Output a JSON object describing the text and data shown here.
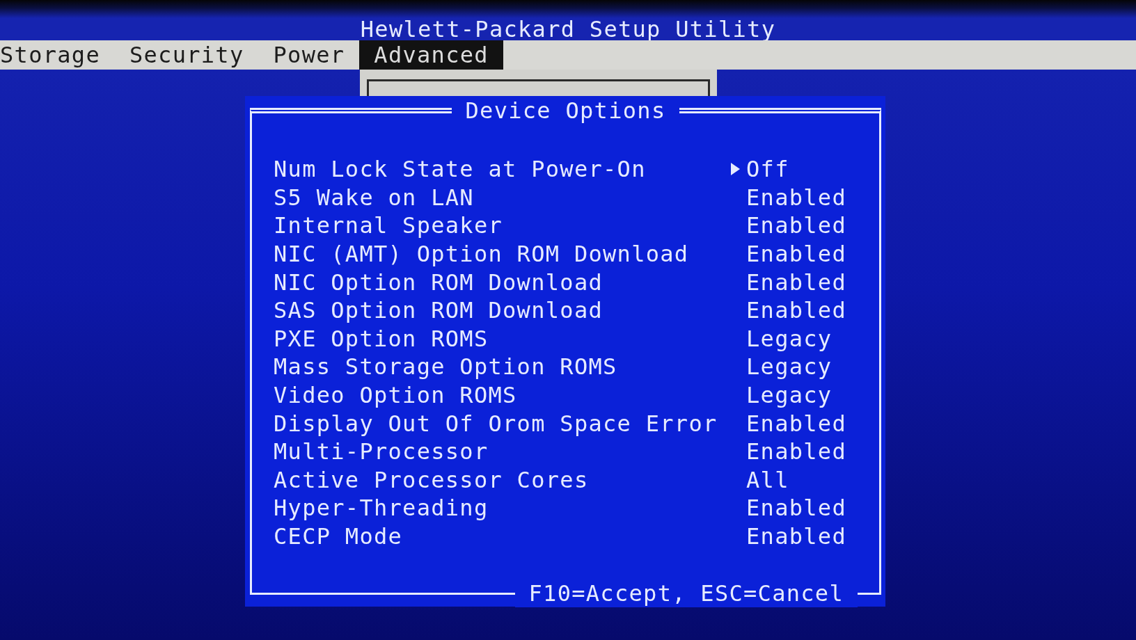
{
  "window": {
    "title": "Hewlett-Packard Setup Utility"
  },
  "menu": [
    {
      "label": "Storage",
      "selected": false
    },
    {
      "label": "Security",
      "selected": false
    },
    {
      "label": "Power",
      "selected": false
    },
    {
      "label": "Advanced",
      "selected": true
    }
  ],
  "dialog": {
    "title": "Device Options",
    "options": [
      {
        "label": "Num Lock State at Power-On",
        "value": "Off",
        "selected": true
      },
      {
        "label": "S5 Wake on LAN",
        "value": "Enabled",
        "selected": false
      },
      {
        "label": "Internal Speaker",
        "value": "Enabled",
        "selected": false
      },
      {
        "label": "NIC (AMT) Option ROM Download",
        "value": "Enabled",
        "selected": false
      },
      {
        "label": "NIC Option ROM Download",
        "value": "Enabled",
        "selected": false
      },
      {
        "label": "SAS Option ROM Download",
        "value": "Enabled",
        "selected": false
      },
      {
        "label": "PXE Option ROMS",
        "value": "Legacy",
        "selected": false
      },
      {
        "label": "Mass Storage Option ROMS",
        "value": "Legacy",
        "selected": false
      },
      {
        "label": "Video Option ROMS",
        "value": "Legacy",
        "selected": false
      },
      {
        "label": "Display Out Of Orom Space Error",
        "value": "Enabled",
        "selected": false
      },
      {
        "label": "Multi-Processor",
        "value": "Enabled",
        "selected": false
      },
      {
        "label": "Active Processor Cores",
        "value": "All",
        "selected": false
      },
      {
        "label": "Hyper-Threading",
        "value": "Enabled",
        "selected": false
      },
      {
        "label": "CECP Mode",
        "value": "Enabled",
        "selected": false
      }
    ],
    "footer": "F10=Accept, ESC=Cancel"
  }
}
